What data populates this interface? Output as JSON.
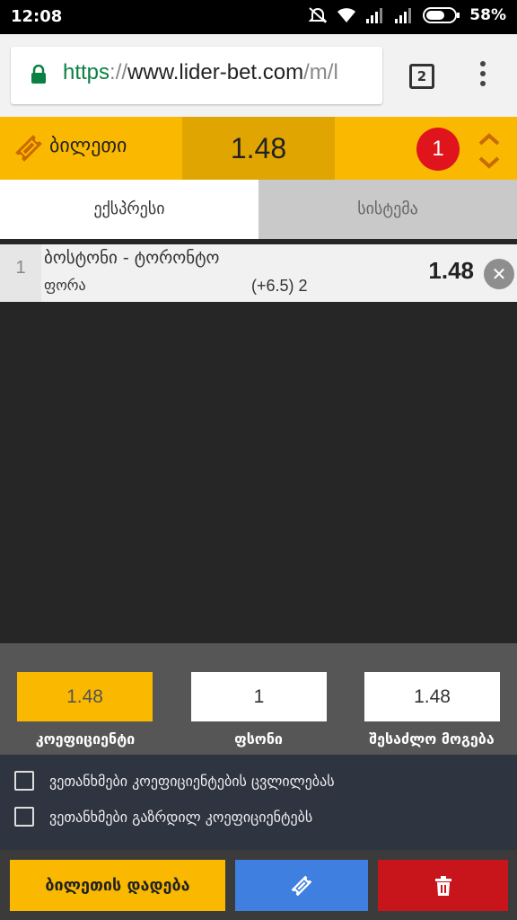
{
  "status_bar": {
    "time": "12:08",
    "battery": "58%",
    "icons": [
      "mute-icon",
      "wifi-icon",
      "signal-icon",
      "signal-icon",
      "battery-icon"
    ]
  },
  "browser": {
    "url_scheme": "https",
    "url_sep": "://",
    "url_host": "www.lider-bet.com",
    "url_path": "/m/l",
    "tab_count": "2"
  },
  "ticket": {
    "title": "ბილეთი",
    "total_odds": "1.48",
    "bet_count": "1",
    "colors": {
      "accent": "#fab900",
      "accent_dark": "#e0a500",
      "badge": "#e0141d"
    }
  },
  "tabs": [
    {
      "label": "ექსპრესი",
      "active": true
    },
    {
      "label": "სისტემა",
      "active": false
    }
  ],
  "bets": [
    {
      "index": "1",
      "match": "ბოსტონი - ტორონტო",
      "market": "ფორა",
      "pick": "(+6.5) 2",
      "odds": "1.48"
    }
  ],
  "summary": {
    "odds_value": "1.48",
    "odds_label": "კოეფიციენტი",
    "stake_value": "1",
    "stake_label": "ფსონი",
    "payout_value": "1.48",
    "payout_label": "შესაძლო მოგება"
  },
  "options": [
    {
      "label": "ვეთანხმები კოეფიციენტების ცვლილებას",
      "checked": false
    },
    {
      "label": "ვეთანხმები გაზრდილ კოეფიციენტებს",
      "checked": false
    }
  ],
  "actions": {
    "place_label": "ბილეთის დადება",
    "ticket_icon": "ticket-icon",
    "delete_icon": "trash-icon",
    "colors": {
      "place": "#fab900",
      "ticket": "#3f7fe0",
      "delete": "#c8151b"
    }
  }
}
